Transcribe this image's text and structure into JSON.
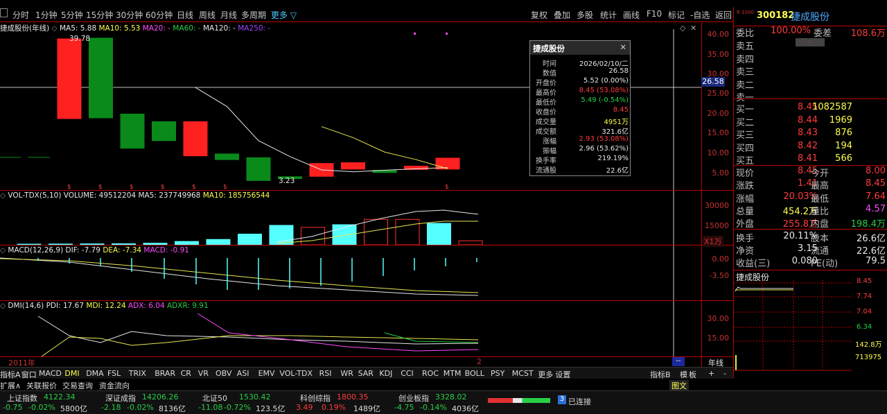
{
  "toolbar": {
    "periods": [
      "分时",
      "1分钟",
      "5分钟",
      "15分钟",
      "30分钟",
      "60分钟",
      "日线",
      "周线",
      "月线",
      "多周期",
      "更多 ▽"
    ],
    "right": [
      "复权",
      "叠加",
      "多股",
      "统计",
      "画线",
      "F10",
      "标记",
      "-自选",
      "返回"
    ]
  },
  "main_chart": {
    "title": "捷成股份(年线)",
    "ma": {
      "ma5": "MA5: 5.88",
      "ma10": "MA10: 5.53",
      "ma20": "MA20: -",
      "ma60": "MA60: -",
      "ma120": "MA120: -",
      "ma250": "MA250: -"
    },
    "axis": [
      "40.00",
      "35.00",
      "30.00",
      "25.00",
      "20.00",
      "15.00",
      "10.00",
      "5.00"
    ],
    "cursor_price": "26.58",
    "max_label": "39.78",
    "min_label": "3.23",
    "year_label": "2011年",
    "cursor_year": "2"
  },
  "chart_data": {
    "type": "candlestick",
    "ylim": [
      0,
      42
    ],
    "candles": [
      [
        18.8,
        39.8
      ],
      [
        19,
        40
      ],
      [
        11,
        20
      ],
      [
        13,
        18
      ],
      [
        9,
        18
      ],
      [
        8,
        9.5
      ],
      [
        2.5,
        8.5
      ],
      [
        3,
        3.5
      ],
      [
        3.6,
        7
      ],
      [
        5.5,
        7.2
      ],
      [
        4.6,
        5.2
      ],
      [
        5.4,
        6.3
      ],
      [
        5.5,
        8.4
      ]
    ],
    "up": [
      true,
      false,
      false,
      false,
      true,
      false,
      false,
      false,
      true,
      true,
      false,
      true,
      true
    ],
    "ma5": [
      null,
      null,
      null,
      null,
      27,
      22,
      13,
      8.8,
      5.3,
      4.8,
      5.2,
      5.6,
      5.9
    ],
    "ma10": [
      null,
      null,
      null,
      null,
      null,
      null,
      null,
      null,
      16.7,
      13.8,
      10,
      8,
      5.6
    ]
  },
  "volume": {
    "title": "VOL-TDX(5,10)",
    "vol": "VOLUME: 49512204",
    "ma5": "MA5: 237749968",
    "ma10": "MA10: 185756544",
    "axis": [
      "30000",
      "15000"
    ],
    "unit": "X1万",
    "bars": [
      500,
      600,
      700,
      800,
      1200,
      2500,
      4000,
      8000,
      14500,
      13000,
      15000,
      19000,
      19000,
      16000,
      3000
    ]
  },
  "macd": {
    "title": "MACD(12,26,9)",
    "dif": "DIF: -7.79",
    "dea": "DEA: -7.34",
    "macd": "MACD: -0.91",
    "axis": [
      "0.00",
      "-3.50"
    ]
  },
  "dmi": {
    "title": "DMI(14,6)",
    "pdi": "PDI: 17.67",
    "mdi": "MDI: 12.24",
    "adx": "ADX: 6.04",
    "adxr": "ADXR: 9.91",
    "axis": [
      "30.00",
      "15.00"
    ]
  },
  "period_label": "年线",
  "indicator_tabs": [
    "指标A",
    "窗口",
    "MACD",
    "DMI",
    "DMA",
    "FSL",
    "TRIX",
    "BRAR",
    "CR",
    "VR",
    "OBV",
    "ASI",
    "EMV",
    "VOL-TDX",
    "RSI",
    "WR",
    "SAR",
    "KDJ",
    "CCI",
    "ROC",
    "MTM",
    "BOLL",
    "PSY",
    "MCST",
    "更多",
    "设置"
  ],
  "tabs_right": [
    "指标B",
    "模",
    "板",
    "+",
    "-"
  ],
  "bottom_links": [
    "扩展∧",
    "关联报价",
    "交易查询",
    "资金流向"
  ],
  "popup": {
    "title": "捷成股份",
    "rows": [
      {
        "k": "时间",
        "v": "2026/02/10/二",
        "c": "wht"
      },
      {
        "k": "数值",
        "v": "26.58",
        "c": "wht"
      },
      {
        "k": "开盘价",
        "v": "5.52 (0.00%)",
        "c": "wht"
      },
      {
        "k": "最高价",
        "v": "8.45 (53.08%)",
        "c": "red"
      },
      {
        "k": "最低价",
        "v": "5.49 (-0.54%)",
        "c": "grn"
      },
      {
        "k": "收盘价",
        "v": "8.45",
        "c": "red"
      },
      {
        "k": "成交量",
        "v": "4951万",
        "c": "yel"
      },
      {
        "k": "成交额",
        "v": "321.6亿",
        "c": "wht"
      },
      {
        "k": "涨幅",
        "v": "2.93 (53.08%)",
        "c": "red"
      },
      {
        "k": "振幅",
        "v": "2.96 (53.62%)",
        "c": "wht"
      },
      {
        "k": "换手率",
        "v": "219.19%",
        "c": "wht"
      },
      {
        "k": "流通股",
        "v": "22.6亿",
        "c": "wht"
      }
    ]
  },
  "quote": {
    "code": "300182",
    "name": "捷成股份",
    "badge": "R 1000",
    "weibi_label": "委比",
    "weibi": "100.00%",
    "weicha_label": "委差",
    "weicha": "108.6万",
    "sells": [
      "卖五",
      "卖四",
      "卖三",
      "卖二",
      "卖一"
    ],
    "buys": [
      {
        "l": "买一",
        "p": "8.45",
        "v": "1082587"
      },
      {
        "l": "买二",
        "p": "8.44",
        "v": "1969"
      },
      {
        "l": "买三",
        "p": "8.43",
        "v": "876"
      },
      {
        "l": "买四",
        "p": "8.42",
        "v": "194"
      },
      {
        "l": "买五",
        "p": "8.41",
        "v": "566"
      }
    ],
    "stats": [
      {
        "a": "现价",
        "av": "8.45",
        "ac": "red",
        "b": "今开",
        "bv": "8.00",
        "bc": "red"
      },
      {
        "a": "涨跌",
        "av": "1.41",
        "ac": "red",
        "b": "最高",
        "bv": "8.45",
        "bc": "red"
      },
      {
        "a": "涨幅",
        "av": "20.03%",
        "ac": "red",
        "b": "最低",
        "bv": "7.64",
        "bc": "red"
      },
      {
        "a": "总量",
        "av": "454.2万",
        "ac": "yel",
        "b": "量比",
        "bv": "4.57",
        "bc": "mag"
      },
      {
        "a": "外盘",
        "av": "255.8万",
        "ac": "red",
        "b": "内盘",
        "bv": "198.4万",
        "bc": "grn"
      },
      {
        "a": "换手",
        "av": "20.11%",
        "ac": "wht",
        "b": "股本",
        "bv": "26.6亿",
        "bc": "wht"
      },
      {
        "a": "净资",
        "av": "3.15",
        "ac": "wht",
        "b": "流通",
        "bv": "22.6亿",
        "bc": "wht"
      },
      {
        "a": "收益(三)",
        "av": "0.080",
        "ac": "wht",
        "b": "PE(动)",
        "bv": "79.5",
        "bc": "wht"
      }
    ]
  },
  "mini": {
    "name": "捷成股份",
    "prices": [
      "8.45",
      "7.74",
      "7.04",
      "6.34",
      "142.8万",
      "713975"
    ],
    "tab": "图文"
  },
  "status": {
    "indices": [
      {
        "name": "上证指数",
        "val": "4122.34",
        "chg": "-0.75",
        "pct": "-0.02%",
        "amt": "5800亿",
        "c": "grn"
      },
      {
        "name": "深证成指",
        "val": "14206.26",
        "chg": "-2.18",
        "pct": "-0.02%",
        "amt": "8136亿",
        "c": "grn"
      },
      {
        "name": "北证50",
        "val": "1530.42",
        "chg": "-11.08",
        "pct": "-0.72%",
        "amt": "123.5亿",
        "c": "grn"
      },
      {
        "name": "科创综指",
        "val": "1800.35",
        "chg": "3.49",
        "pct": "0.19%",
        "amt": "1489亿",
        "c": "red"
      },
      {
        "name": "创业板指",
        "val": "3328.02",
        "chg": "-4.75",
        "pct": "-0.14%",
        "amt": "4036亿",
        "c": "grn"
      }
    ],
    "conn_num": "3",
    "conn": "已连接"
  }
}
